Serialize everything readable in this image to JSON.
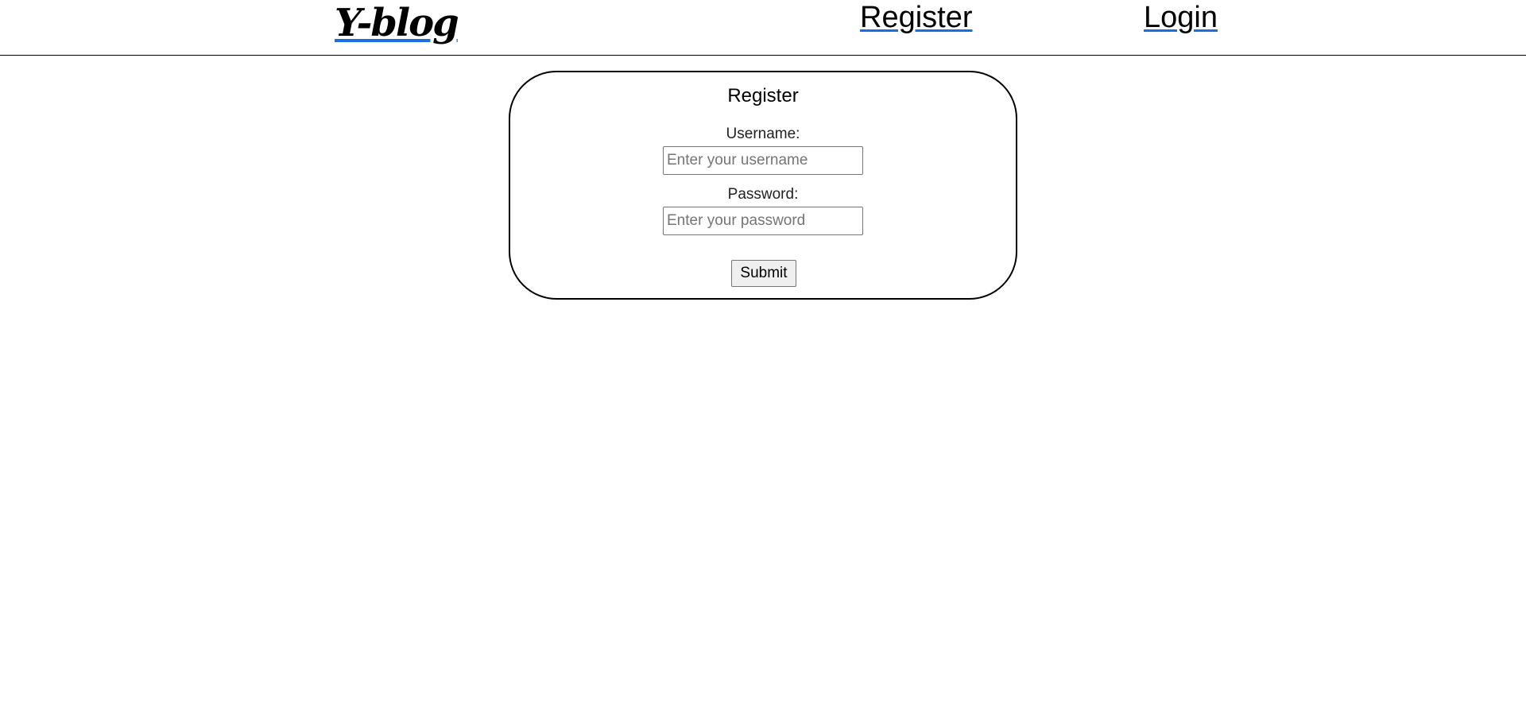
{
  "navbar": {
    "brand": "Y-blog",
    "links": [
      {
        "label": "Register"
      },
      {
        "label": "Login"
      }
    ],
    "accent_color": "#1a6fe0"
  },
  "register_form": {
    "title": "Register",
    "username": {
      "label": "Username:",
      "placeholder": "Enter your username",
      "value": ""
    },
    "password": {
      "label": "Password:",
      "placeholder": "Enter your password",
      "value": ""
    },
    "submit_label": "Submit"
  }
}
